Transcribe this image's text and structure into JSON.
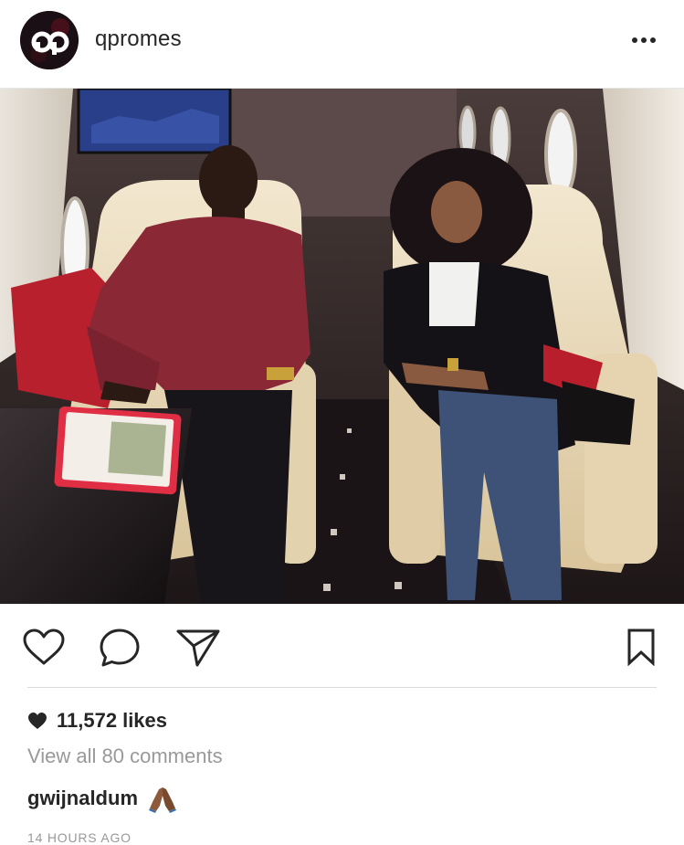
{
  "post": {
    "author": {
      "username": "qpromes",
      "avatar_text": "QP",
      "avatar_icon": "qp-logo-avatar"
    },
    "menu_icon": "more-options-icon",
    "photo_icon": "post-photo"
  },
  "actions": {
    "like_icon": "heart-outline-icon",
    "comment_icon": "comment-bubble-icon",
    "share_icon": "paper-plane-icon",
    "save_icon": "bookmark-icon"
  },
  "likes": {
    "icon": "heart-filled-icon",
    "count": "11,572",
    "suffix": "likes"
  },
  "comments": {
    "view_all": "View all 80 comments",
    "items": [
      {
        "author": "gwijnaldum",
        "text_icon": "folded-hands-emoji"
      }
    ]
  },
  "timestamp": "14 HOURS AGO",
  "colors": {
    "text": "#262626",
    "muted": "#999999",
    "divider": "#dbdbdb"
  }
}
